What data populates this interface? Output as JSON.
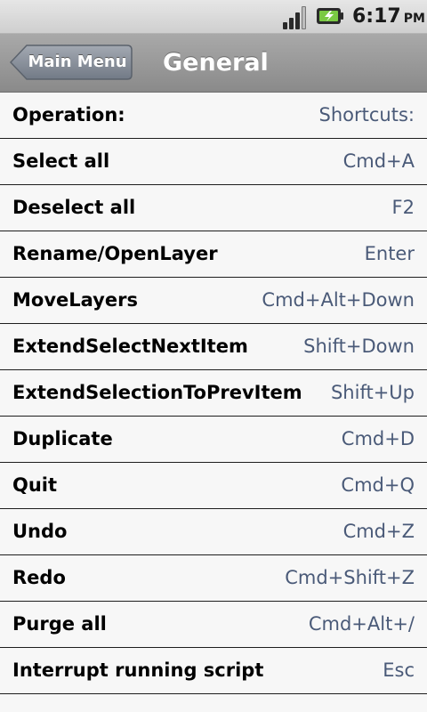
{
  "status_bar": {
    "time": "6:17",
    "ampm": "PM",
    "icons": [
      "signal-icon",
      "battery-charging-icon"
    ]
  },
  "header": {
    "back_label": "Main Menu",
    "title": "General"
  },
  "table": {
    "header": {
      "operation": "Operation:",
      "shortcut": "Shortcuts:"
    },
    "rows": [
      {
        "operation": "Select all",
        "shortcut": "Cmd+A"
      },
      {
        "operation": "Deselect all",
        "shortcut": "F2"
      },
      {
        "operation": "Rename/OpenLayer",
        "shortcut": "Enter"
      },
      {
        "operation": "MoveLayers",
        "shortcut": "Cmd+Alt+Down"
      },
      {
        "operation": "ExtendSelectNextItem",
        "shortcut": "Shift+Down"
      },
      {
        "operation": "ExtendSelectionToPrevItem",
        "shortcut": "Shift+Up"
      },
      {
        "operation": "Duplicate",
        "shortcut": "Cmd+D"
      },
      {
        "operation": "Quit",
        "shortcut": "Cmd+Q"
      },
      {
        "operation": "Undo",
        "shortcut": "Cmd+Z"
      },
      {
        "operation": "Redo",
        "shortcut": "Cmd+Shift+Z"
      },
      {
        "operation": "Purge all",
        "shortcut": "Cmd+Alt+/"
      },
      {
        "operation": "Interrupt running script",
        "shortcut": "Esc"
      }
    ]
  },
  "colors": {
    "shortcut_text": "#4a5a78",
    "title_bar": "#9a9a9a",
    "row_divider": "#1e1e1e"
  }
}
